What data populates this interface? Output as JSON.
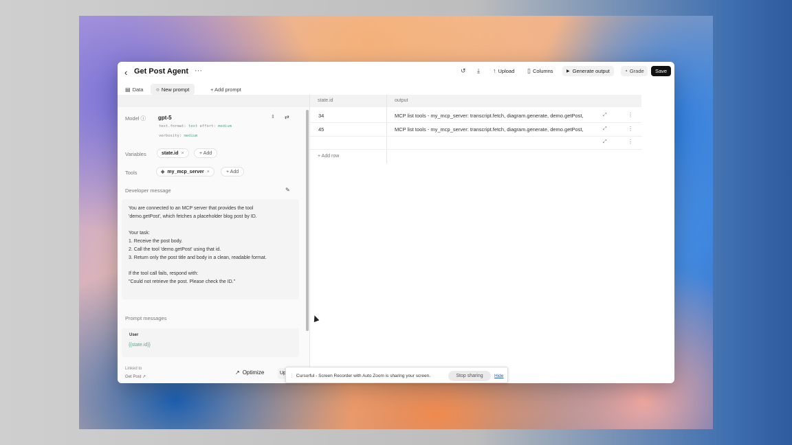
{
  "header": {
    "back_icon": "chevron-left-icon",
    "title": "Get Post Agent",
    "more": "···",
    "upload": "Upload",
    "columns": "Columns",
    "generate": "Generate output",
    "grade": "Grade",
    "save": "Save"
  },
  "tabs": {
    "data": "Data",
    "new_prompt": "New prompt",
    "add_prompt": "+ Add prompt"
  },
  "left": {
    "model_label": "Model",
    "model_name": "gpt-5",
    "params": {
      "text_format_key": "text.format:",
      "text_format_val": "text",
      "effort_key": "effort:",
      "effort_val": "medium",
      "verbosity_key": "verbosity:",
      "verbosity_val": "medium"
    },
    "variables_label": "Variables",
    "variable_chip": "state.id",
    "add": "+ Add",
    "tools_label": "Tools",
    "tool_chip": "my_mcp_server",
    "developer_label": "Developer message",
    "developer_message": [
      "You are connected to an MCP server that provides the tool",
      "'demo.getPost', which fetches a placeholder blog post by ID.",
      "",
      "Your task:",
      "1. Receive the post body.",
      "2. Call the tool 'demo.getPost' using that id.",
      "3. Return only the post title and body in a clean, readable format.",
      "",
      "If the tool call fails, respond with:",
      "\"Could not retrieve the post. Please check the ID.\""
    ],
    "prompt_messages_label": "Prompt messages",
    "user_role": "User",
    "user_var": "{{state.id}}",
    "linked_to": "Linked to",
    "linked_name": "Get Post ↗",
    "optimize": "Optimize",
    "up": "Up"
  },
  "table": {
    "columns": [
      "state.id",
      "output"
    ],
    "rows": [
      {
        "id": "34",
        "output": "MCP list tools - my_mcp_server: transcript.fetch, diagram.generate, demo.getPost,"
      },
      {
        "id": "45",
        "output": "MCP list tools - my_mcp_server: transcript.fetch, diagram.generate, demo.getPost,"
      },
      {
        "id": "",
        "output": ""
      }
    ],
    "add_row": "+ Add row"
  },
  "sharing": {
    "text": "Cursorful - Screen Recorder with Auto Zoom is sharing your screen.",
    "stop": "Stop sharing",
    "hide": "Hide"
  }
}
